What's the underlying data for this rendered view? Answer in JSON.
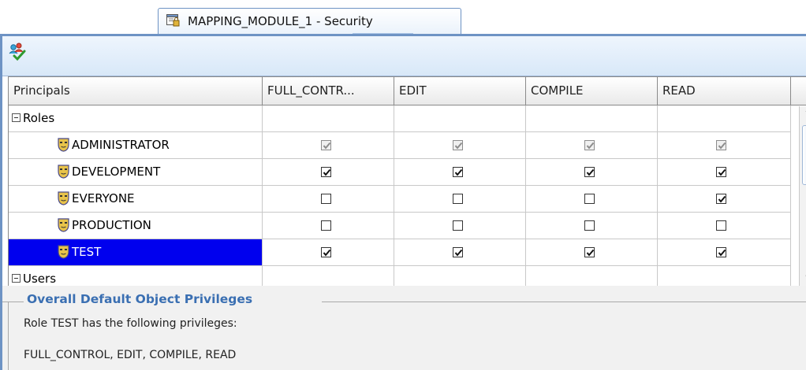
{
  "tab": {
    "title": "MAPPING_MODULE_1 - Security"
  },
  "grid": {
    "columns": [
      "Principals",
      "FULL_CONTR...",
      "EDIT",
      "COMPILE",
      "READ"
    ],
    "rows": [
      {
        "kind": "group",
        "label": "Roles"
      },
      {
        "kind": "role",
        "label": "ADMINISTRATOR",
        "selected": false,
        "privileges": [
          true,
          true,
          true,
          true
        ],
        "disabled": true
      },
      {
        "kind": "role",
        "label": "DEVELOPMENT",
        "selected": false,
        "privileges": [
          true,
          true,
          true,
          true
        ],
        "disabled": false
      },
      {
        "kind": "role",
        "label": "EVERYONE",
        "selected": false,
        "privileges": [
          false,
          false,
          false,
          true
        ],
        "disabled": false
      },
      {
        "kind": "role",
        "label": "PRODUCTION",
        "selected": false,
        "privileges": [
          false,
          false,
          false,
          false
        ],
        "disabled": false
      },
      {
        "kind": "role",
        "label": "TEST",
        "selected": true,
        "privileges": [
          true,
          true,
          true,
          true
        ],
        "disabled": false
      },
      {
        "kind": "group",
        "label": "Users"
      }
    ]
  },
  "privileges_section": {
    "title": "Overall Default Object Privileges",
    "description": "Role TEST has the following privileges:",
    "privilege_list": "FULL_CONTROL, EDIT, COMPILE, READ"
  },
  "icons": {
    "tab": "security-document-icon",
    "toolbar": "manage-principals-icon",
    "role": "role-mask-icon",
    "group_toggle": "collapse-minus-icon"
  },
  "colors": {
    "selection": "#0000ee",
    "panel_border": "#6e93c4",
    "section_title": "#3a6fb2"
  }
}
